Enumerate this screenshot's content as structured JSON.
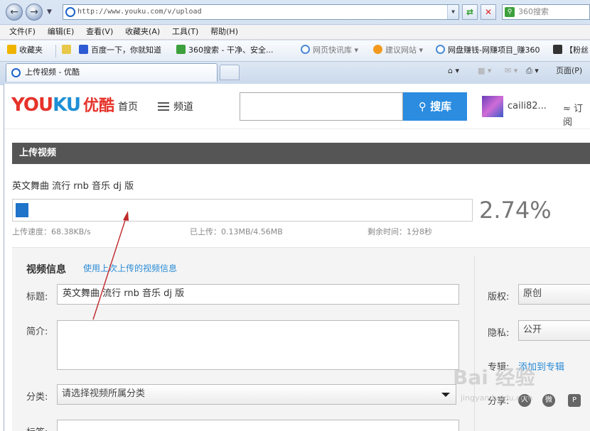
{
  "browser": {
    "url": "http://www.youku.com/v/upload",
    "search_placeholder": "360搜索",
    "menu": [
      "文件(F)",
      "编辑(E)",
      "查看(V)",
      "收藏夹(A)",
      "工具(T)",
      "帮助(H)"
    ],
    "favorites_label": "收藏夹",
    "favorites": [
      {
        "label": "百度一下，你就知道"
      },
      {
        "label": "360搜索 - 干净、安全..."
      },
      {
        "label": "网页快讯库 ▾"
      },
      {
        "label": "建议网站 ▾"
      },
      {
        "label": "网盘赚钱-网赚项目_赚360"
      },
      {
        "label": "【粉丝"
      }
    ],
    "tab_title": "上传视频 - 优酷",
    "page_menu": "页面(P)"
  },
  "header": {
    "logo_en_a": "YOU",
    "logo_en_b": "KU",
    "logo_cn": "优酷",
    "nav_home": "首页",
    "nav_channel": "频道",
    "search_button": "搜库",
    "username": "caili82...",
    "subscribe": "订阅"
  },
  "upload": {
    "section_title": "上传视频",
    "video_name": "英文舞曲 流行 rnb 音乐 dj 版",
    "progress_percent": 2.74,
    "progress_text": "2.74%",
    "speed_text": "上传速度：68.38KB/s",
    "uploaded_text": "已上传：0.13MB/4.56MB",
    "remaining_text": "剩余时间：1分8秒"
  },
  "info": {
    "heading": "视频信息",
    "use_last_link": "使用上次上传的视频信息",
    "title_label": "标题:",
    "title_value": "英文舞曲 流行 rnb 音乐 dj 版",
    "intro_label": "简介:",
    "category_label": "分类:",
    "category_placeholder": "请选择视频所属分类",
    "tags_label": "标签:",
    "copyright_label": "版权:",
    "copyright_value": "原创",
    "privacy_label": "隐私:",
    "privacy_value": "公开",
    "album_label": "专辑:",
    "album_link": "添加到专辑",
    "share_label": "分享:"
  },
  "watermark": {
    "brand": "Bai 经验",
    "site": "jingyan.baidu.com"
  },
  "colors": {
    "youku_red": "#e6332a",
    "youku_blue": "#1e8fd6",
    "search_button": "#2b8ce0",
    "progress_fill": "#1f73c9",
    "section_bar": "#555555",
    "link": "#2a8bd6",
    "annotation_arrow": "#c0282a"
  }
}
